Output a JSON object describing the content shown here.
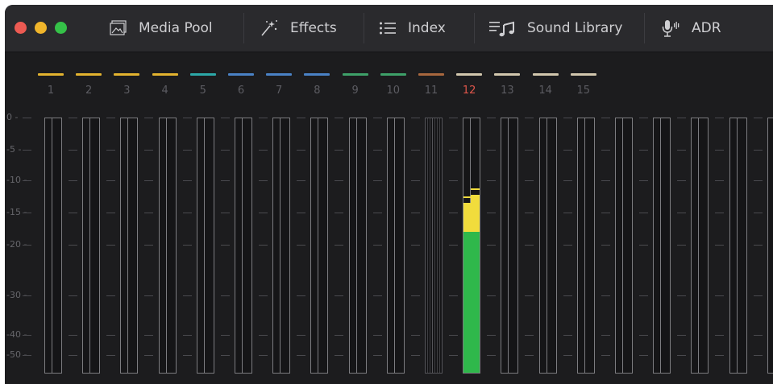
{
  "toolbar": {
    "media_pool": "Media Pool",
    "effects": "Effects",
    "index": "Index",
    "sound_library": "Sound Library",
    "adr": "ADR"
  },
  "colors": {
    "close": "#ec5a52",
    "minimize": "#f0b52b",
    "zoom": "#35c148",
    "meter_green": "#2fb84b",
    "meter_yellow": "#f1dc3c"
  },
  "channels": [
    {
      "label": "1",
      "color": "#e3b32f",
      "selected": false
    },
    {
      "label": "2",
      "color": "#e3b32f",
      "selected": false
    },
    {
      "label": "3",
      "color": "#e3b32f",
      "selected": false
    },
    {
      "label": "4",
      "color": "#e3b32f",
      "selected": false
    },
    {
      "label": "5",
      "color": "#2ca8a8",
      "selected": false
    },
    {
      "label": "6",
      "color": "#4a82c6",
      "selected": false
    },
    {
      "label": "7",
      "color": "#4a82c6",
      "selected": false
    },
    {
      "label": "8",
      "color": "#4a82c6",
      "selected": false
    },
    {
      "label": "9",
      "color": "#3ea169",
      "selected": false
    },
    {
      "label": "10",
      "color": "#3ea169",
      "selected": false
    },
    {
      "label": "11",
      "color": "#a8673e",
      "selected": false
    },
    {
      "label": "12",
      "color": "#d2c7ae",
      "selected": true
    },
    {
      "label": "13",
      "color": "#d2c7ae",
      "selected": false
    },
    {
      "label": "14",
      "color": "#d2c7ae",
      "selected": false
    },
    {
      "label": "15",
      "color": "#d2c7ae",
      "selected": false
    }
  ],
  "scale_labels": [
    "0 -",
    "-5 -",
    "-10 -",
    "-15 -",
    "-20 -",
    "-30 -",
    "-40 -",
    "-50 -"
  ],
  "meter_levels": {
    "channel": "12",
    "left": {
      "level_db": -13.5,
      "peak_db": -12.5
    },
    "right": {
      "level_db": -12.3,
      "peak_db": -11.3
    },
    "green_top_db": -18
  }
}
